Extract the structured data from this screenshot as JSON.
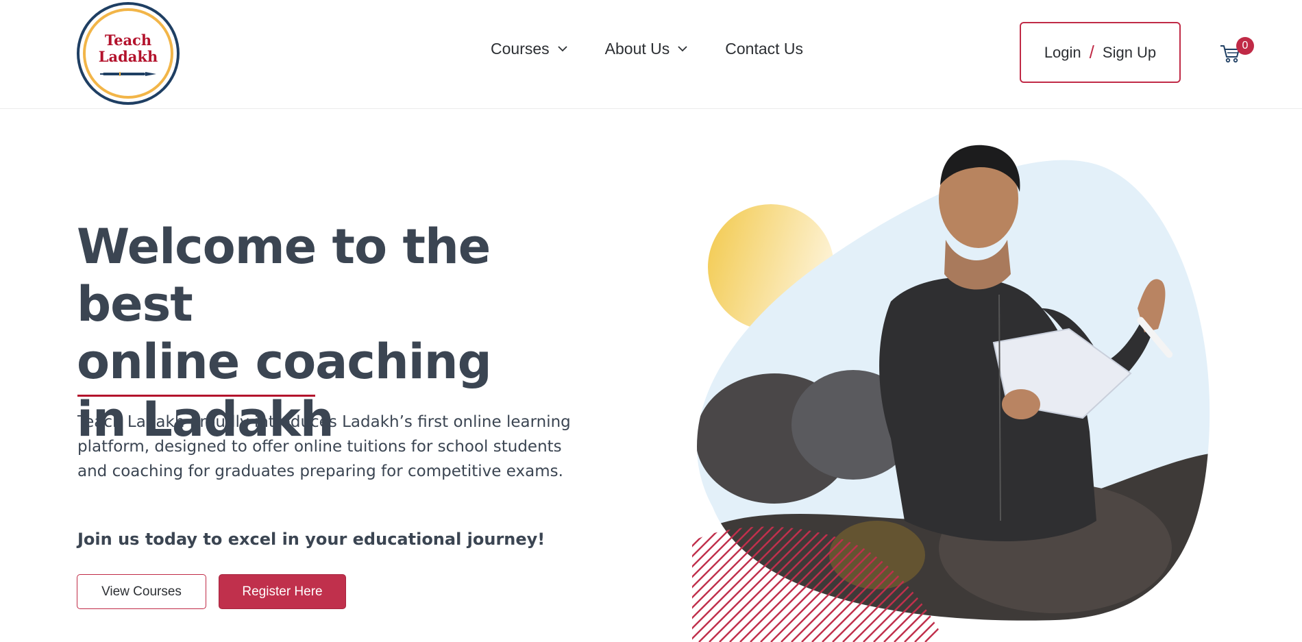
{
  "brand": {
    "logo_line1": "Teach",
    "logo_line2": "Ladakh"
  },
  "nav": {
    "items": [
      {
        "label": "Courses",
        "has_dropdown": true
      },
      {
        "label": "About Us",
        "has_dropdown": true
      },
      {
        "label": "Contact Us",
        "has_dropdown": false
      }
    ]
  },
  "auth": {
    "login_label": "Login",
    "separator": "/",
    "signup_label": "Sign Up"
  },
  "cart": {
    "count": "0",
    "icon": "cart-icon"
  },
  "hero": {
    "title_line1": "Welcome to the best",
    "title_line2": "online coaching",
    "title_line3": "in Ladakh",
    "description": "Teach Ladakh proudly introduces Ladakh’s first online learning platform, designed to offer online tuitions for school students and coaching for graduates preparing for competitive exams.",
    "join_text": "Join us today to excel in your educational journey!",
    "view_courses_label": "View Courses",
    "register_label": "Register Here"
  },
  "colors": {
    "accent": "#c0304c",
    "navy": "#1f3f63",
    "gold": "#f2b548",
    "text": "#3b4552",
    "blob": "#e3f0f9"
  }
}
